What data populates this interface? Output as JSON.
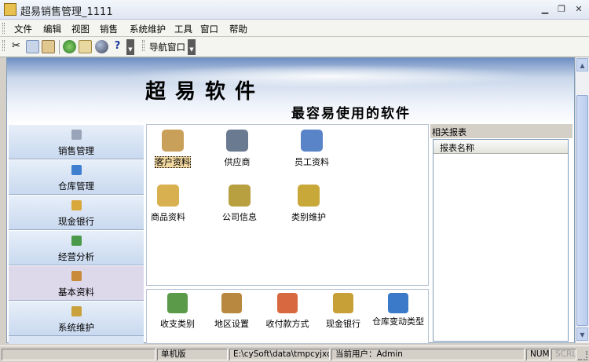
{
  "window": {
    "title": "超易销售管理_1111",
    "minimize_icon": "minimize-icon",
    "maximize_icon": "maximize-icon",
    "close_icon": "close-icon"
  },
  "menu": [
    "文件",
    "编辑",
    "视图",
    "销售",
    "系统维护",
    "工具",
    "窗口",
    "帮助"
  ],
  "toolbar": {
    "buttons": [
      "cut-icon",
      "copy-icon",
      "paste-icon",
      "refresh-icon",
      "edit-icon",
      "globe-icon",
      "help-icon"
    ],
    "nav_label": "导航窗口"
  },
  "banner": {
    "title": "超易软件",
    "subtitle": "最容易使用的软件"
  },
  "left_nav": [
    {
      "label": "销售管理",
      "icon": "cart-icon",
      "color": "#9aa4b8"
    },
    {
      "label": "仓库管理",
      "icon": "warehouse-icon",
      "color": "#3f7fd0"
    },
    {
      "label": "现金银行",
      "icon": "money-bag-icon",
      "color": "#d9a83a"
    },
    {
      "label": "经营分析",
      "icon": "chart-icon",
      "color": "#4a9a4a"
    },
    {
      "label": "基本资料",
      "icon": "book-icon",
      "color": "#c98a3a",
      "active": true
    },
    {
      "label": "系统维护",
      "icon": "hammer-icon",
      "color": "#c9a03a"
    }
  ],
  "center_items": [
    {
      "label": "客户资料",
      "icon": "customer-icon",
      "color": "#c9a05a",
      "selected": true
    },
    {
      "label": "供应商",
      "icon": "supplier-icon",
      "color": "#6a7a90"
    },
    {
      "label": "员工资料",
      "icon": "staff-icon",
      "color": "#5a84c8"
    },
    {
      "label": "商品资料",
      "icon": "goods-icon",
      "color": "#d8b050"
    },
    {
      "label": "公司信息",
      "icon": "company-info-icon",
      "color": "#b8a040"
    },
    {
      "label": "类别维护",
      "icon": "category-icon",
      "color": "#c8a838"
    }
  ],
  "bottom_items": [
    {
      "label": "收支类别",
      "icon": "income-expense-icon",
      "color": "#5a9a48"
    },
    {
      "label": "地区设置",
      "icon": "region-icon",
      "color": "#b88840"
    },
    {
      "label": "收付款方式",
      "icon": "payment-method-icon",
      "color": "#d86840"
    },
    {
      "label": "现金银行",
      "icon": "cash-bank-icon",
      "color": "#c8a038"
    },
    {
      "label": "仓库变动类型",
      "icon": "stock-change-icon",
      "color": "#3a7ac8"
    }
  ],
  "right_panel": {
    "title": "相关报表",
    "column": "报表名称"
  },
  "status": {
    "mode": "单机版",
    "path": "E:\\cySoft\\data\\tmpcyjxc.sys",
    "user": "当前用户：Admin",
    "num": "NUM",
    "scrl": "SCRL"
  }
}
